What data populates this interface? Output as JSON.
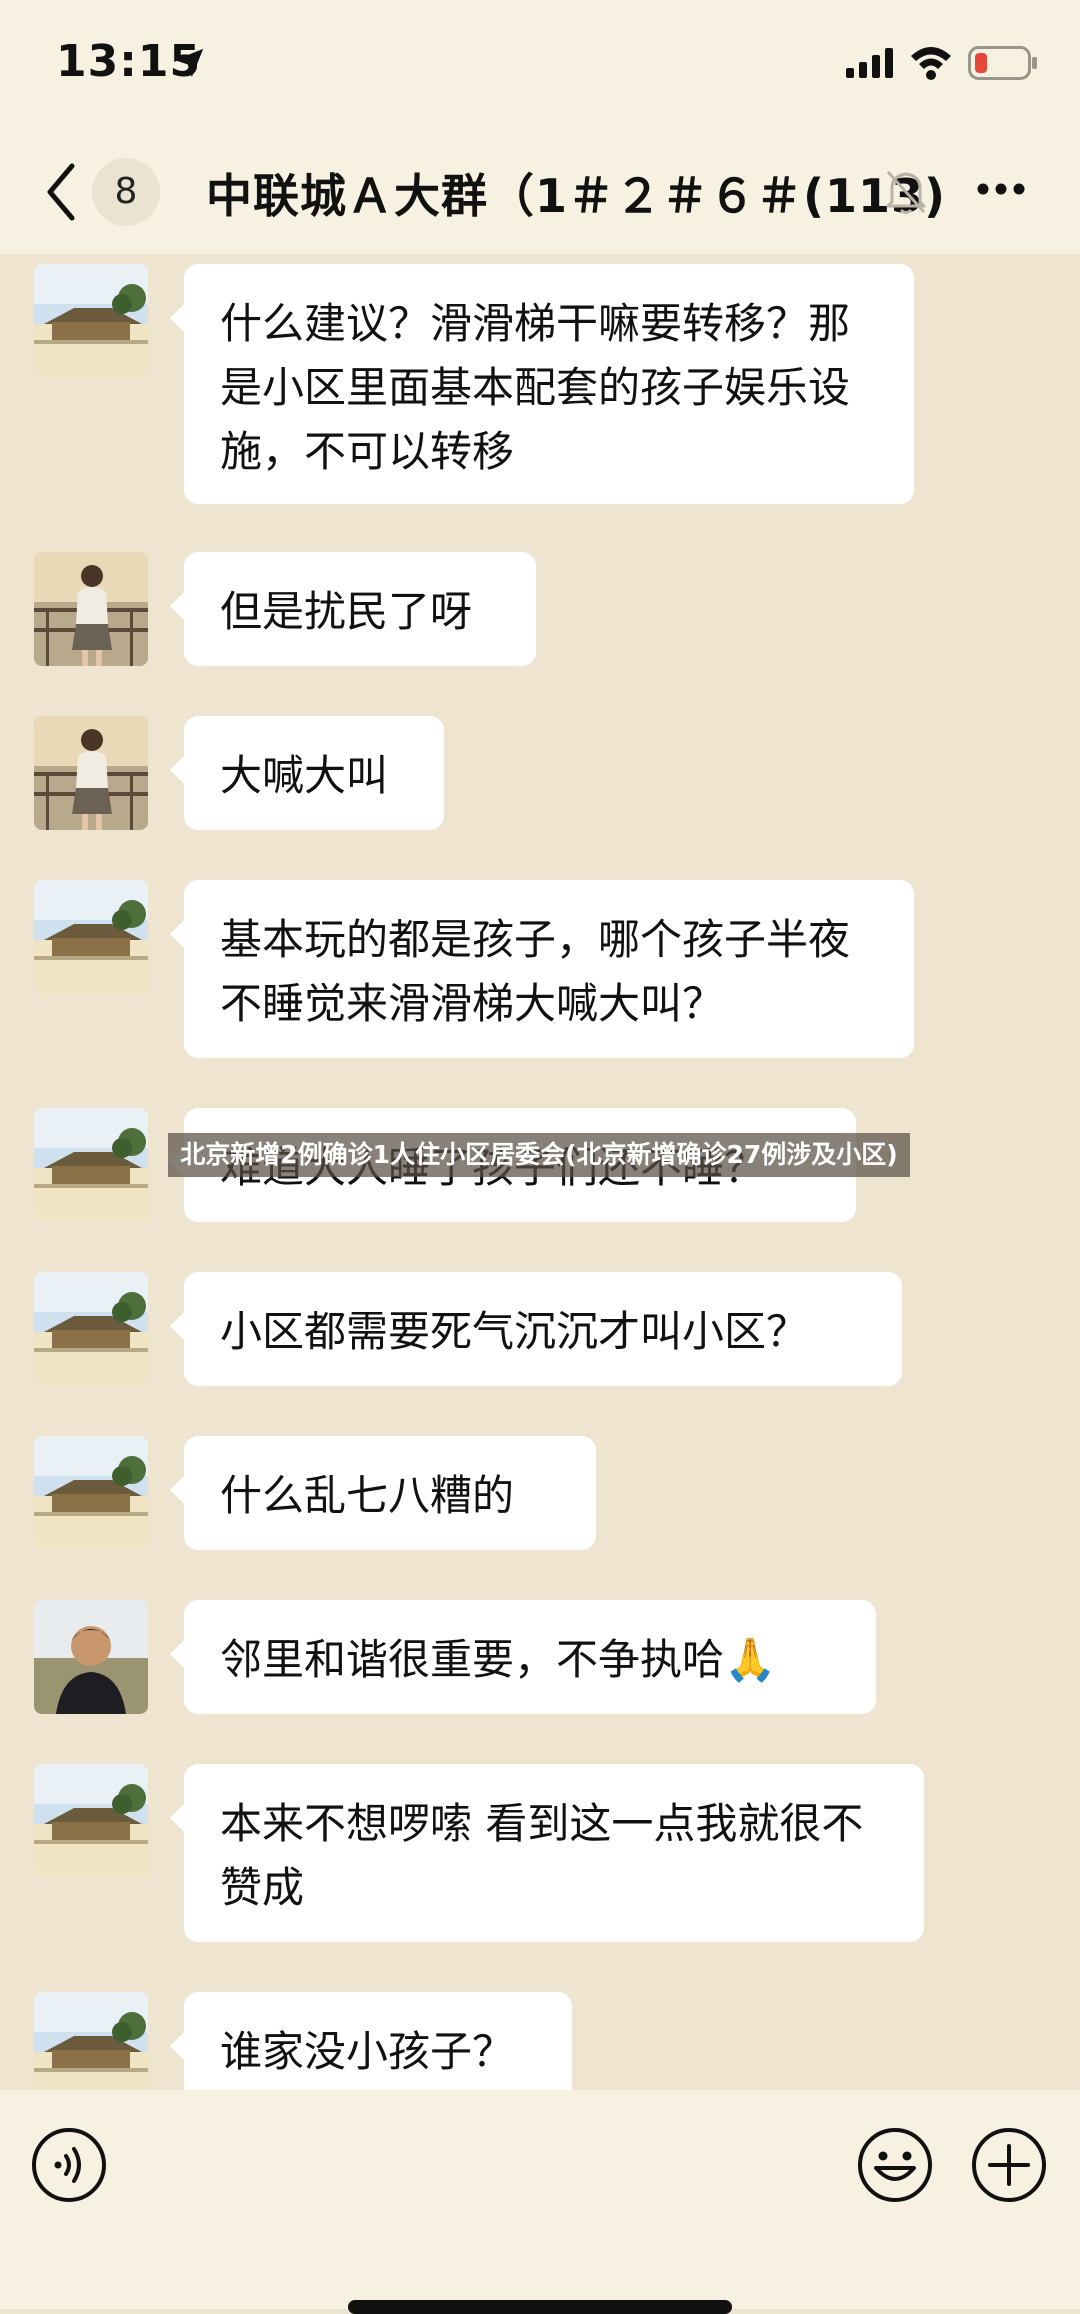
{
  "status_bar": {
    "time": "13:15"
  },
  "header": {
    "unread_count": "8",
    "title": "中联城Ａ大群（1＃２＃６＃(113)"
  },
  "messages": [
    {
      "sender": "landscape",
      "text": "什么建议？滑滑梯干嘛要转移？那是小区里面基本配套的孩子娱乐设施，不可以转移"
    },
    {
      "sender": "girl",
      "text": "但是扰民了呀"
    },
    {
      "sender": "girl",
      "text": "大喊大叫"
    },
    {
      "sender": "landscape",
      "text": "基本玩的都是孩子，哪个孩子半夜不睡觉来滑滑梯大喊大叫？"
    },
    {
      "sender": "landscape",
      "text": "难道大人睡了孩子们还不睡？"
    },
    {
      "sender": "landscape",
      "text": "小区都需要死气沉沉才叫小区？"
    },
    {
      "sender": "landscape",
      "text": "什么乱七八糟的"
    },
    {
      "sender": "man",
      "text": "邻里和谐很重要，不争执哈🙏"
    },
    {
      "sender": "landscape",
      "text": "本来不想啰嗦 看到这一点我就很不赞成"
    },
    {
      "sender": "landscape",
      "text": "谁家没小孩子？"
    }
  ],
  "watermark": "北京新增2例确诊1人住小区居委会(北京新增确诊27例涉及小区)",
  "icons": {
    "back": "chevron-left-icon",
    "mute": "bell-slash-icon",
    "more": "more-icon",
    "voice": "voice-icon",
    "emoji": "emoji-icon",
    "plus": "plus-icon"
  }
}
